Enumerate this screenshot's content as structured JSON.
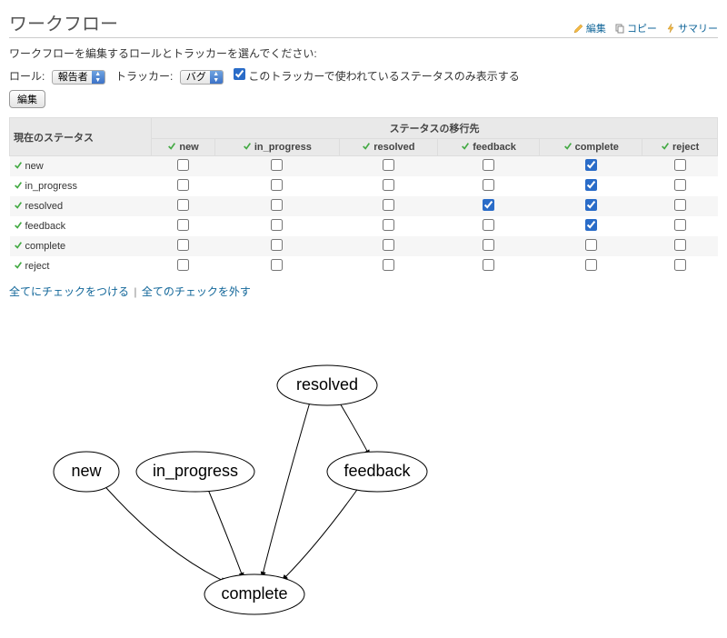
{
  "header": {
    "title": "ワークフロー",
    "edit": "編集",
    "copy": "コピー",
    "summary": "サマリー"
  },
  "hint": "ワークフローを編集するロールとトラッカーを選んでください:",
  "filters": {
    "role_label": "ロール:",
    "role_value": "報告者",
    "tracker_label": "トラッカー:",
    "tracker_value": "バグ",
    "only_used_label": "このトラッカーで使われているステータスのみ表示する",
    "only_used_checked": true,
    "submit": "編集"
  },
  "table": {
    "current_header": "現在のステータス",
    "target_header": "ステータスの移行先",
    "statuses": [
      "new",
      "in_progress",
      "resolved",
      "feedback",
      "complete",
      "reject"
    ],
    "rows": [
      {
        "name": "new",
        "checked": [
          false,
          false,
          false,
          false,
          true,
          false
        ]
      },
      {
        "name": "in_progress",
        "checked": [
          false,
          false,
          false,
          false,
          true,
          false
        ]
      },
      {
        "name": "resolved",
        "checked": [
          false,
          false,
          false,
          true,
          true,
          false
        ]
      },
      {
        "name": "feedback",
        "checked": [
          false,
          false,
          false,
          false,
          true,
          false
        ]
      },
      {
        "name": "complete",
        "checked": [
          false,
          false,
          false,
          false,
          false,
          false
        ]
      },
      {
        "name": "reject",
        "checked": [
          false,
          false,
          false,
          false,
          false,
          false
        ]
      }
    ]
  },
  "links": {
    "check_all": "全てにチェックをつける",
    "uncheck_all": "全てのチェックを外す"
  },
  "diagram": {
    "nodes": [
      "new",
      "in_progress",
      "resolved",
      "feedback",
      "complete"
    ],
    "edges": [
      [
        "new",
        "complete"
      ],
      [
        "in_progress",
        "complete"
      ],
      [
        "resolved",
        "feedback"
      ],
      [
        "resolved",
        "complete"
      ],
      [
        "feedback",
        "complete"
      ]
    ]
  }
}
